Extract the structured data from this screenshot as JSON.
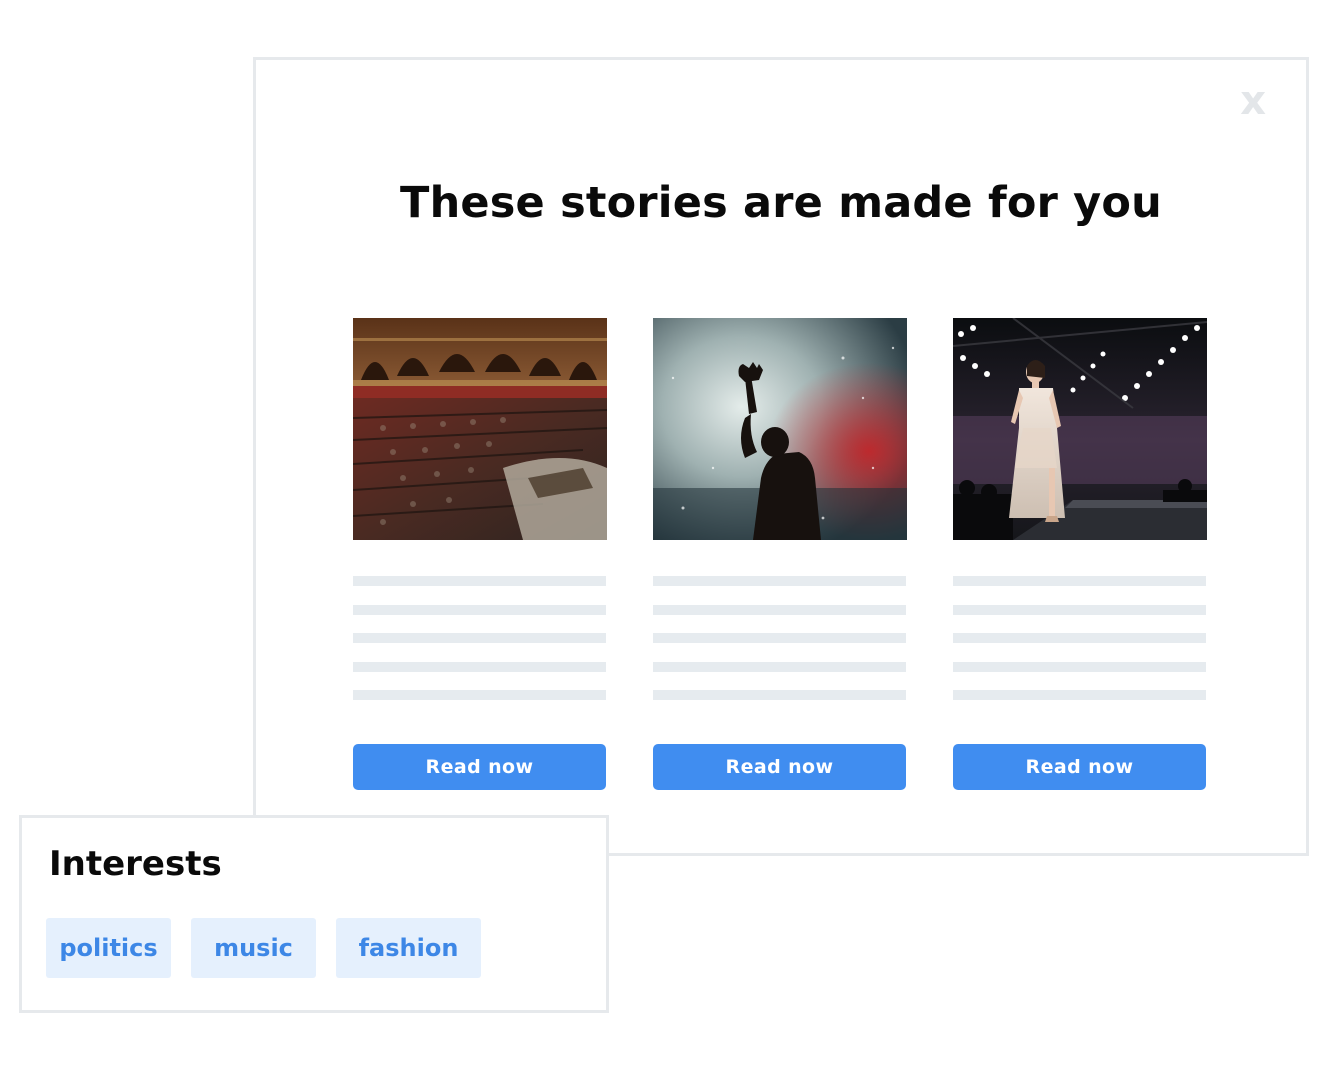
{
  "modal": {
    "close_label": "x",
    "title": "These stories are made for you",
    "cards": [
      {
        "topic": "politics",
        "image": "parliament-chamber-photo",
        "button_label": "Read now"
      },
      {
        "topic": "music",
        "image": "concert-performer-photo",
        "button_label": "Read now"
      },
      {
        "topic": "fashion",
        "image": "runway-model-photo",
        "button_label": "Read now"
      }
    ]
  },
  "interests": {
    "title": "Interests",
    "tags": [
      "politics",
      "music",
      "fashion"
    ]
  },
  "colors": {
    "accent": "#408df0",
    "chip_bg": "#e5f0fd",
    "chip_text": "#3d87e6",
    "border": "#e6e9ec",
    "placeholder_line": "#e6ebef"
  }
}
